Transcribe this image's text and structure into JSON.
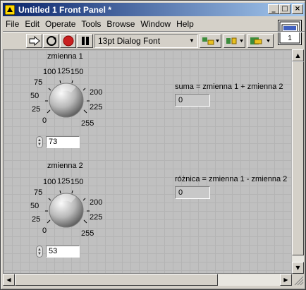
{
  "window": {
    "title": "Untitled 1 Front Panel *"
  },
  "menu": [
    "File",
    "Edit",
    "Operate",
    "Tools",
    "Browse",
    "Window",
    "Help"
  ],
  "toolbar": {
    "font": "13pt Dialog Font"
  },
  "knob1": {
    "label": "zmienna 1",
    "ticks": [
      "0",
      "25",
      "50",
      "75",
      "100",
      "125",
      "150",
      "200",
      "225",
      "255"
    ],
    "value": "73"
  },
  "knob2": {
    "label": "zmienna 2",
    "ticks": [
      "0",
      "25",
      "50",
      "75",
      "100",
      "125",
      "150",
      "200",
      "225",
      "255"
    ],
    "value": "53"
  },
  "ind_sum": {
    "label": "suma = zmienna 1 + zmienna 2",
    "value": "0"
  },
  "ind_diff": {
    "label": "różnica = zmienna 1 - zmienna 2",
    "value": "0"
  }
}
